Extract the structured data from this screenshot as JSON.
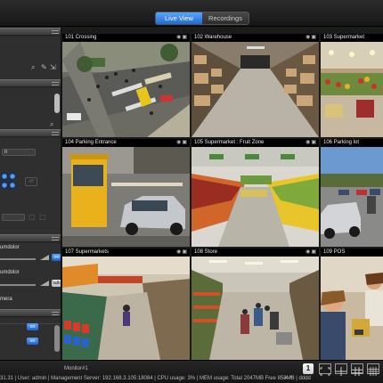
{
  "tabs": {
    "live_view": "Live View",
    "recordings": "Recordings"
  },
  "colors": {
    "accent": "#2a7fe6",
    "panel_header": "#4a4a4a",
    "background": "#1b1b1b"
  },
  "left_panel": {
    "ptz_label_1": "umdolor",
    "ptz_label_2": "umdolor",
    "ptz_label_3": "mera",
    "on": "on",
    "talk": "talk",
    "off": "off",
    "icons": [
      "search-icon",
      "edit-icon",
      "export-icon",
      "search-icon"
    ]
  },
  "cameras": [
    {
      "label": "101 Crossing"
    },
    {
      "label": "102 Warehouse"
    },
    {
      "label": "103 Supermarket"
    },
    {
      "label": "104 Parking Entrance"
    },
    {
      "label": "105 Supermarket : Fruit Zone"
    },
    {
      "label": "106 Parking lot"
    },
    {
      "label": "107 Supermarkets"
    },
    {
      "label": "108 Store"
    },
    {
      "label": "109 POS"
    }
  ],
  "status": {
    "monitor": "Monitor#1",
    "text": "31.31 | User: admin | Management Server: 192.168.3.105:18084 | CPU usage: 3% | MEM usage: Total 2047MB  Free 858MB | dddd",
    "layout_1": "1"
  }
}
